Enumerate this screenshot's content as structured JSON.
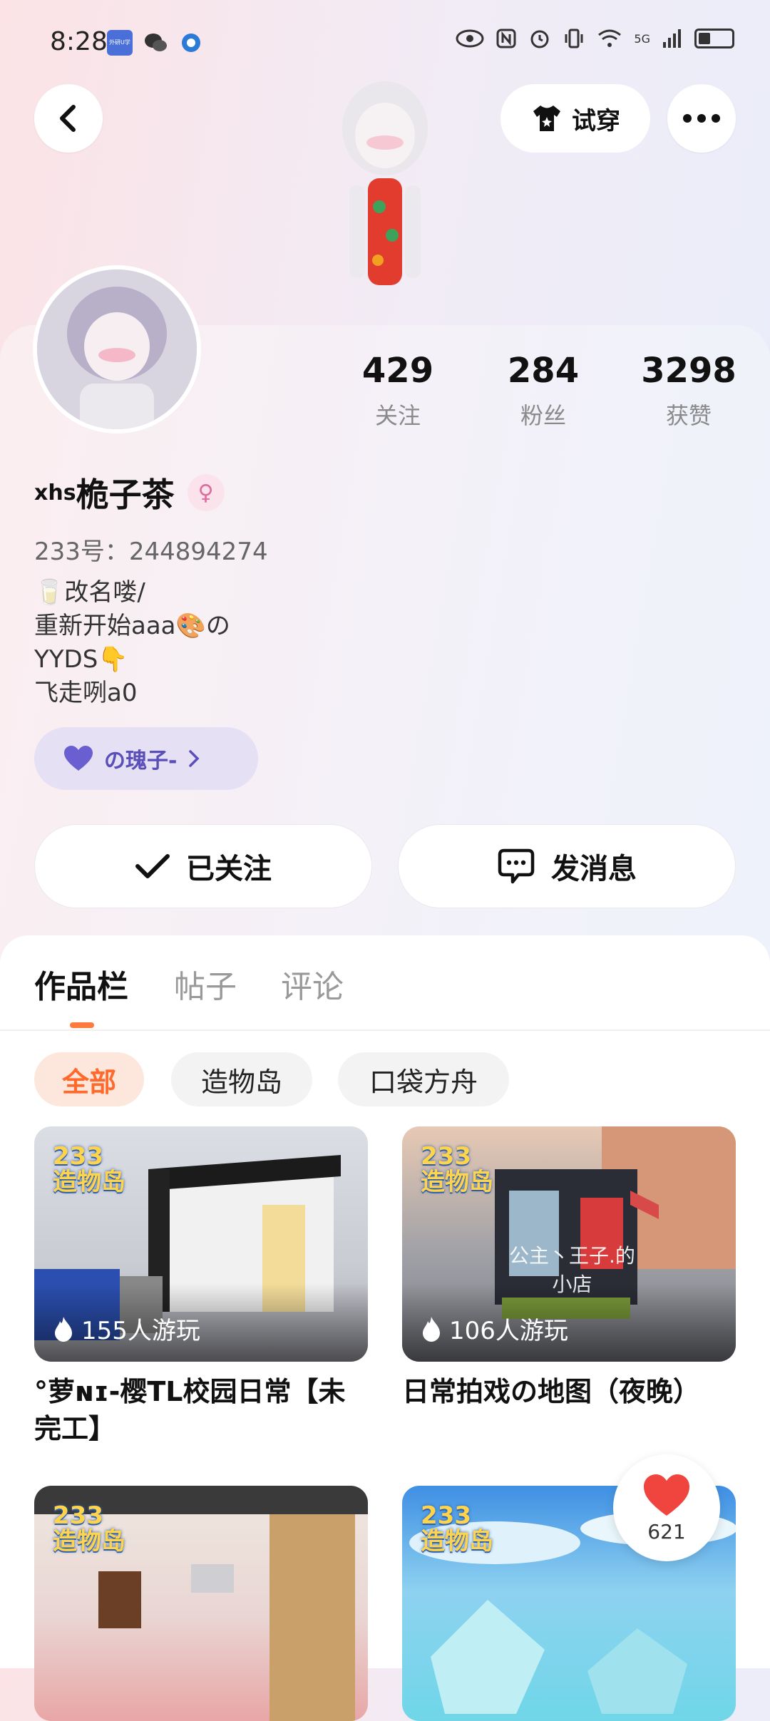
{
  "status_bar": {
    "time": "8:28",
    "network": "5G",
    "app_badges": [
      {
        "icon": "study-app-icon",
        "color": "#4a6fd8",
        "label": "外研U学"
      },
      {
        "icon": "wechat-icon",
        "color": "#333333",
        "label": ""
      },
      {
        "icon": "browser-icon",
        "color": "#2a7ad8",
        "label": ""
      }
    ]
  },
  "header": {
    "try_on_label": "试穿"
  },
  "profile": {
    "stats": [
      {
        "value": "429",
        "label": "关注"
      },
      {
        "value": "284",
        "label": "粉丝"
      },
      {
        "value": "3298",
        "label": "获赞"
      }
    ],
    "name_prefix": "xhs",
    "name": "桅子茶",
    "gender_symbol": "♀",
    "user_id": "233号：244894274",
    "bio_lines": [
      "🥛改名喽/",
      "重新开始aaa🎨の",
      "YYDS👇",
      "飞走咧a0"
    ],
    "guild_label": "の瑰子-",
    "follow_label": "已关注",
    "message_label": "发消息"
  },
  "tabs": [
    {
      "label": "作品栏",
      "active": true
    },
    {
      "label": "帖子",
      "active": false
    },
    {
      "label": "评论",
      "active": false
    }
  ],
  "filters": [
    {
      "label": "全部",
      "active": true
    },
    {
      "label": "造物岛",
      "active": false
    },
    {
      "label": "口袋方舟",
      "active": false
    }
  ],
  "works": [
    {
      "badge": "233\n造物岛",
      "plays": "155人游玩",
      "title": "°萝ɴɪ-樱TL校园日常【未完工】",
      "overlay": ""
    },
    {
      "badge": "233\n造物岛",
      "plays": "106人游玩",
      "title": "日常拍戏の地图（夜晚）",
      "overlay": "公主丶王子.的\n小店"
    },
    {
      "badge": "233\n造物岛",
      "plays": "",
      "title": "",
      "overlay": ""
    },
    {
      "badge": "233\n造物岛",
      "plays": "",
      "title": "",
      "overlay": ""
    }
  ],
  "like_float": {
    "count": "621"
  },
  "colors": {
    "accent": "#ff6a2c",
    "heart": "#f0453e",
    "guild": "#5a4fb8"
  }
}
